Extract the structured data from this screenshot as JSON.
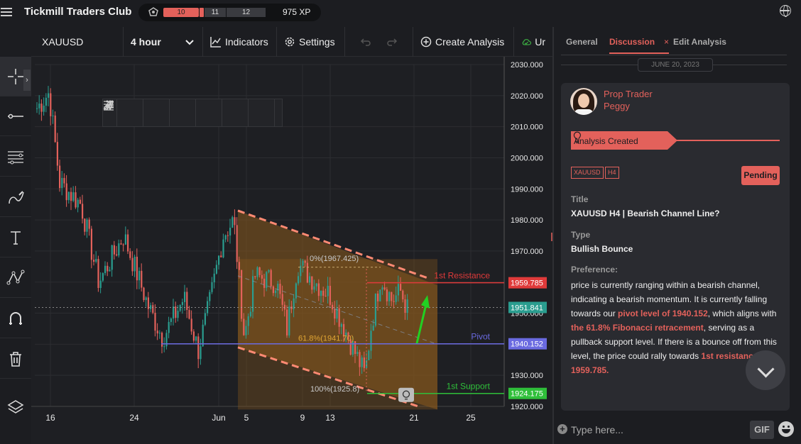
{
  "app": {
    "brand": "Tickmill Traders Club",
    "xp_segments": [
      "10",
      "11",
      "12"
    ],
    "xp": "975 XP"
  },
  "toolbar": {
    "symbol": "XAUUSD",
    "timeframe": "4 hour",
    "indicators": "Indicators",
    "settings": "Settings",
    "create_analysis": "Create Analysis",
    "cut_off": "Ur"
  },
  "left_tools": [
    "crosshair-tool",
    "line-tool",
    "fib-tool",
    "brush-tool",
    "text-tool",
    "pattern-tool",
    "magnet-tool",
    "trash-tool",
    "layers-tool"
  ],
  "chart_data": {
    "type": "candlestick",
    "symbol": "XAUUSD",
    "y_ticks": [
      "2030.000",
      "2020.000",
      "2010.000",
      "2000.000",
      "1990.000",
      "1980.000",
      "1970.000",
      "1960.000",
      "1950.000",
      "1940.000",
      "1930.000",
      "1920.000"
    ],
    "x_ticks": [
      "16",
      "24",
      "Jun",
      "5",
      "9",
      "13",
      "21",
      "25"
    ],
    "ylim": [
      1920,
      2030
    ],
    "levels": [
      {
        "name": "1st Resistance",
        "value": 1959.785,
        "label": "1959.785",
        "color": "#e03a3a"
      },
      {
        "name": "Pivot",
        "value": 1940.152,
        "label": "1940.152",
        "color": "#6a6ae0"
      },
      {
        "name": "1st Support",
        "value": 1924.175,
        "label": "1924.175",
        "color": "#2fbf3a"
      }
    ],
    "current_price": {
      "value": 1951.841,
      "label": "1951.841",
      "color": "#2a9d8f"
    },
    "fib_labels": [
      "0%(1967.425)",
      "61.8%(1941.70)",
      "100%(1925.8)"
    ],
    "channel": {
      "upper": [
        1983,
        1959
      ],
      "lower": [
        1939,
        1919
      ]
    }
  },
  "panel": {
    "tabs": [
      "General",
      "Discussion",
      "Edit Analysis"
    ],
    "active_tab": "Discussion",
    "date": "JUNE 20, 2023",
    "author_role": "Prop Trader",
    "author_name": "Peggy",
    "event": "Analysis Created",
    "tags": [
      "XAUUSD",
      "H4"
    ],
    "status": "Pending",
    "title_label": "Title",
    "title": "XAUUSD H4 | Bearish Channel Line?",
    "type_label": "Type",
    "type": "Bullish Bounce",
    "preference_label": "Preference:",
    "preference": {
      "p1": " price is currently ranging within a bearish channel, indicating a bearish momentum. It is currently falling towards our ",
      "h1": "pivot level of 1940.152",
      "p2": ", which aligns with ",
      "h2": "the 61.8% Fibonacci retracement",
      "p3": ", serving as a pullback support level. If there is a bounce off from this level, the price could rally towards ",
      "h3": "1st resistance at 1959.785."
    }
  },
  "chat": {
    "placeholder": "Type here...",
    "gif": "GIF"
  }
}
